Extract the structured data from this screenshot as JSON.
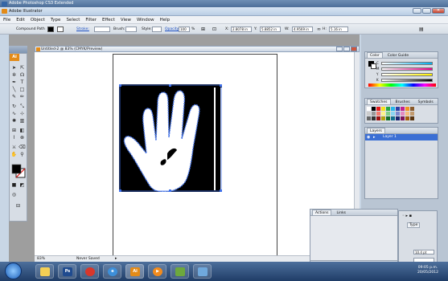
{
  "titles": {
    "photoshop": "Adobe Photoshop CS3 Extended",
    "illustrator": "Adobe Illustrator"
  },
  "menu": [
    "File",
    "Edit",
    "Object",
    "Type",
    "Select",
    "Filter",
    "Effect",
    "View",
    "Window",
    "Help"
  ],
  "controlbar": {
    "selection_label": "Compound Path",
    "stroke_link": "Stroke:",
    "brush_label": "Brush:",
    "style_label": "Style:",
    "opacity_link": "Opacity:",
    "opacity_value": "100",
    "opacity_unit": "%",
    "x_label": "X:",
    "x_value": "2.8078 in",
    "y_label": "Y:",
    "y_value": "5.8852 in",
    "w_label": "W:",
    "w_value": "4.9569 in",
    "h_label": "H:",
    "h_value": "5.16 in"
  },
  "document": {
    "tab_title": "Untitled-2 @ 83% (CMYK/Preview)",
    "zoom": "83%",
    "status": "Never Saved"
  },
  "tools": {
    "badge": "Ai"
  },
  "panels": {
    "color_tabs": [
      "Color",
      "Color Guide"
    ],
    "color_channels": [
      "C",
      "M",
      "Y",
      "K"
    ],
    "swatch_tabs": [
      "Swatches",
      "Brushes",
      "Symbols"
    ],
    "layers_tab": "Layers",
    "layer_name": "Layer 1",
    "actions_tabs": [
      "Actions",
      "Links"
    ],
    "type_tab": "Type",
    "font_size": "10.4 pt"
  },
  "taskbar": {
    "time": "09:05 p.m.",
    "date": "20/05/2012"
  },
  "colors": {
    "accent": "#e38b18",
    "selection_blue": "#3e6fe8",
    "layer_highlight": "#3b6fd4"
  }
}
